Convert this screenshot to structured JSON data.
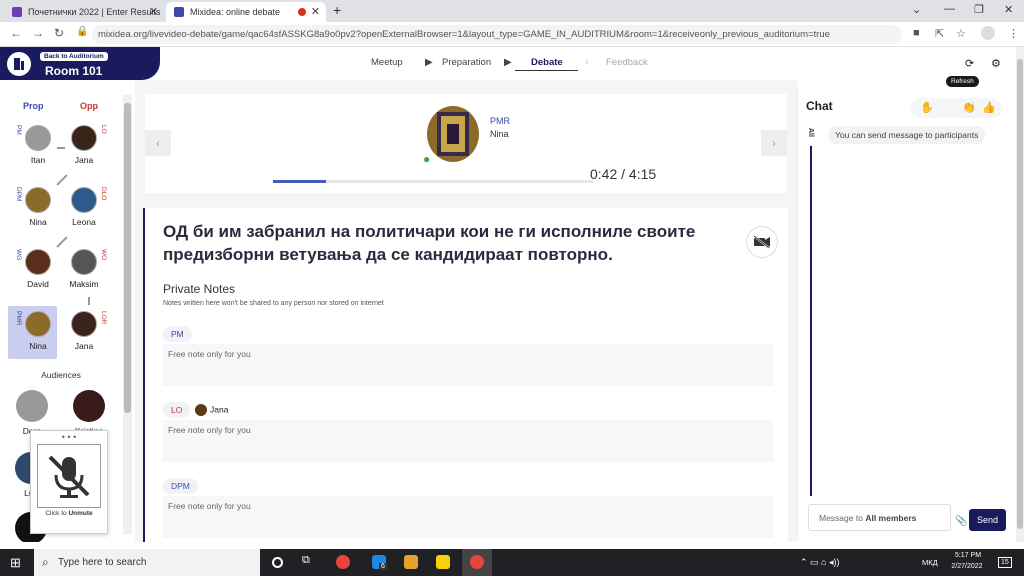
{
  "browser": {
    "tabs": [
      {
        "label": "Почетнички 2022 | Enter Results",
        "active": false
      },
      {
        "label": "Mixidea: online debate",
        "active": true
      }
    ],
    "url": "mixidea.org/livevideo-debate/game/qac64sfASSKG8a9o0pv2?openExternalBrowser=1&layout_type=GAME_IN_AUDITRIUM&room=1&receiveonly_previous_auditorium=true"
  },
  "header": {
    "back_label": "Back to Auditorium",
    "room": "Room 101",
    "steps": [
      "Meetup",
      "Preparation",
      "Debate",
      "Feedback"
    ],
    "current_step": "Debate",
    "refresh_tooltip": "Refresh"
  },
  "speakers": {
    "prop_label": "Prop",
    "opp_label": "Opp",
    "rows": [
      {
        "prop_role": "PM",
        "prop_name": "Itan",
        "opp_role": "LO",
        "opp_name": "Jana"
      },
      {
        "prop_role": "DPM",
        "prop_name": "Nina",
        "opp_role": "DLO",
        "opp_name": "Leona"
      },
      {
        "prop_role": "WG",
        "prop_name": "David",
        "opp_role": "WO",
        "opp_name": "Maksim"
      },
      {
        "prop_role": "PMR",
        "prop_name": "Nina",
        "opp_role": "LOR",
        "opp_name": "Jana"
      }
    ],
    "audiences_label": "Audiences",
    "audiences": [
      "Dora",
      "Kristina",
      "Luk"
    ],
    "mute_popup": {
      "dots": "• • •",
      "prefix": "Click to",
      "action": "Unmute"
    }
  },
  "player": {
    "role": "PMR",
    "name": "Nina",
    "time": "0:42 / 4:15",
    "progress": 0.165
  },
  "motion": {
    "text": "ОД би им забранил на политичари кои не ги исполниле своите предизборни ветувања да се кандидираат повторно.",
    "notes_title": "Private Notes",
    "notes_sub": "Notes written here won't be shared to any person nor stored on internet",
    "notes": [
      {
        "tag": "PM",
        "side": "prop",
        "who": "",
        "placeholder": "Free note only for you"
      },
      {
        "tag": "LO",
        "side": "opp",
        "who": "Jana",
        "placeholder": "Free note only for you"
      },
      {
        "tag": "DPM",
        "side": "prop",
        "who": "",
        "placeholder": "Free note only for you"
      }
    ]
  },
  "chat": {
    "title": "Chat",
    "all": "All",
    "message": "You can send message to participants",
    "input_prefix": "Message to",
    "input_target": "All members",
    "send": "Send"
  },
  "taskbar": {
    "search": "Type here to search",
    "lang": "МКД",
    "time": "5:17 PM",
    "date": "2/27/2022",
    "badge": "6",
    "notif": "15"
  },
  "colors": {
    "navy": "#1a1a5e",
    "prop": "#3b4aa8",
    "opp": "#c0392b"
  }
}
